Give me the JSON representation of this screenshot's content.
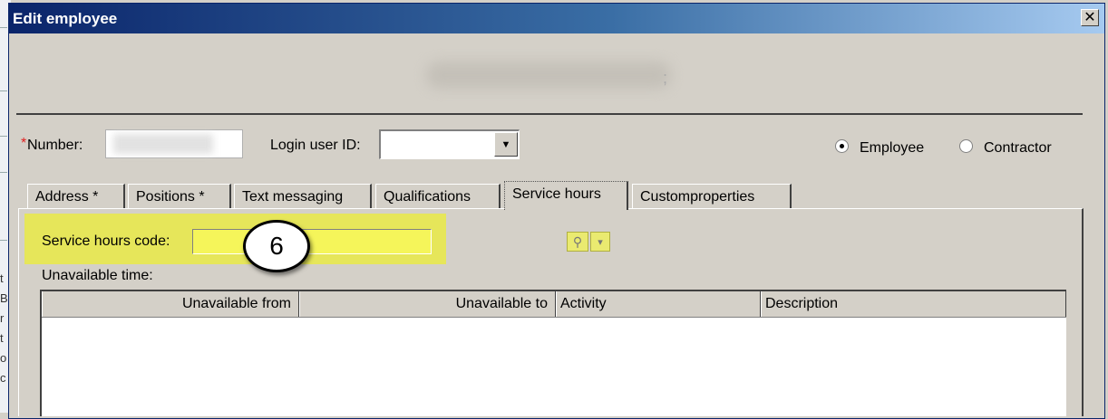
{
  "window": {
    "title": "Edit employee",
    "close_glyph": "✕"
  },
  "form": {
    "number_label": "Number:",
    "required_mark": "*",
    "login_label": "Login user ID:",
    "dropdown_glyph": "▼",
    "radio_employee": "Employee",
    "radio_contractor": "Contractor",
    "selected_type": "Employee"
  },
  "tabs": [
    {
      "label": "Address *"
    },
    {
      "label": "Positions *"
    },
    {
      "label": "Text messaging"
    },
    {
      "label": "Qualifications"
    },
    {
      "label": "Service hours",
      "active": true
    },
    {
      "label": "Customproperties"
    }
  ],
  "service_hours": {
    "code_label": "Service hours code:",
    "code_value": "",
    "unavailable_label": "Unavailable time:",
    "columns": [
      "Unavailable from",
      "Unavailable to",
      "Activity",
      "Description"
    ]
  },
  "callout": {
    "number": "6"
  },
  "icons": {
    "search": "search-icon",
    "menu": "menu-dropdown-icon"
  },
  "colors": {
    "highlight": "#e6e65a",
    "title_bar": "#0a246a",
    "required": "#e02020"
  }
}
